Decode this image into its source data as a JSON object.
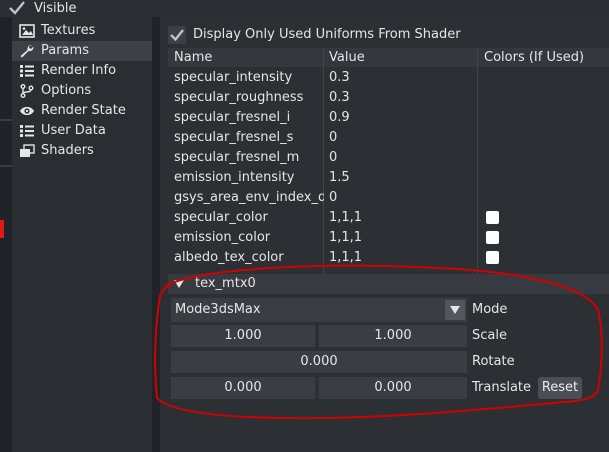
{
  "top": {
    "visible_label": "Visible"
  },
  "sidebar": {
    "items": [
      {
        "label": "Textures",
        "icon": "image-icon"
      },
      {
        "label": "Params",
        "icon": "wrench-icon",
        "active": true
      },
      {
        "label": "Render Info",
        "icon": "list-icon"
      },
      {
        "label": "Options",
        "icon": "branch-icon"
      },
      {
        "label": "Render State",
        "icon": "eye-icon"
      },
      {
        "label": "User Data",
        "icon": "list-icon"
      },
      {
        "label": "Shaders",
        "icon": "layers-icon"
      }
    ]
  },
  "params": {
    "display_only_used_label": "Display Only Used Uniforms From Shader",
    "columns": {
      "name": "Name",
      "value": "Value",
      "colors": "Colors (If Used)"
    },
    "rows": [
      {
        "name": "specular_intensity",
        "value": "0.3",
        "swatch": false
      },
      {
        "name": "specular_roughness",
        "value": "0.3",
        "swatch": false
      },
      {
        "name": "specular_fresnel_i",
        "value": "0.9",
        "swatch": false
      },
      {
        "name": "specular_fresnel_s",
        "value": "0",
        "swatch": false
      },
      {
        "name": "specular_fresnel_m",
        "value": "0",
        "swatch": false
      },
      {
        "name": "emission_intensity",
        "value": "1.5",
        "swatch": false
      },
      {
        "name": "gsys_area_env_index_diffuse",
        "value": "0",
        "swatch": false
      },
      {
        "name": "specular_color",
        "value": "1,1,1",
        "swatch": true
      },
      {
        "name": "emission_color",
        "value": "1,1,1",
        "swatch": true
      },
      {
        "name": "albedo_tex_color",
        "value": "1,1,1",
        "swatch": true
      }
    ]
  },
  "tex_mtx": {
    "title": "tex_mtx0",
    "mode_value": "Mode3dsMax",
    "mode_label": "Mode",
    "scale_x": "1.000",
    "scale_y": "1.000",
    "scale_label": "Scale",
    "rotate": "0.000",
    "rotate_label": "Rotate",
    "translate_x": "0.000",
    "translate_y": "0.000",
    "translate_label": "Translate",
    "reset_label": "Reset"
  },
  "colors": {
    "accent": "#b0c4de",
    "swatch": "#ffffff",
    "annotation": "#d40000",
    "left_marker": "#e01818"
  }
}
